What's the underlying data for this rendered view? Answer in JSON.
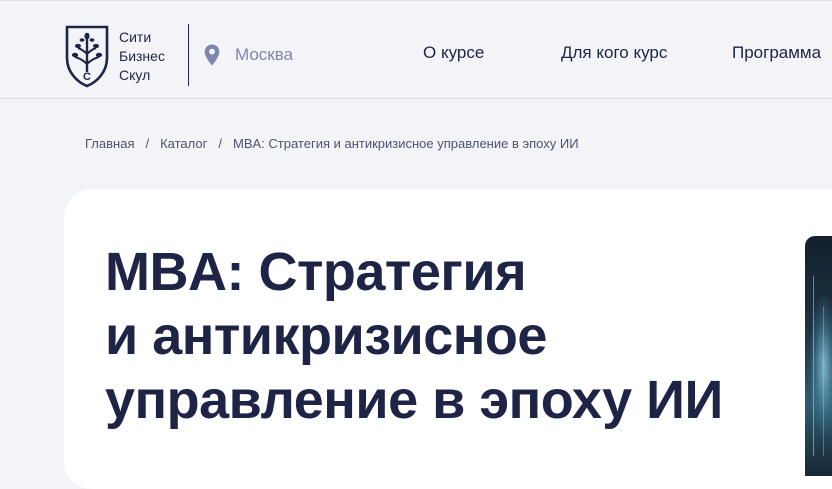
{
  "header": {
    "logo": {
      "lines": [
        "Сити",
        "Бизнес",
        "Скул"
      ],
      "shield_letter": "С",
      "alt_icon": "tree-shield-logo-icon"
    },
    "city": {
      "label": "Москва",
      "icon": "location-pin-icon"
    },
    "nav": [
      {
        "label": "О курсе"
      },
      {
        "label": "Для кого курс"
      },
      {
        "label": "Программа"
      }
    ]
  },
  "breadcrumb": {
    "items": [
      {
        "label": "Главная"
      },
      {
        "label": "Каталог"
      }
    ],
    "separator": "/",
    "current": "MBA: Стратегия и антикризисное управление в эпоху ИИ"
  },
  "hero": {
    "title_lines": [
      "MBA: Стратегия",
      "и антикризисное",
      "управление в эпоху ИИ"
    ]
  },
  "colors": {
    "background": "#f3f4f7",
    "text_primary": "#1e2445",
    "city_text": "#7e86ad",
    "card_background": "#ffffff"
  }
}
